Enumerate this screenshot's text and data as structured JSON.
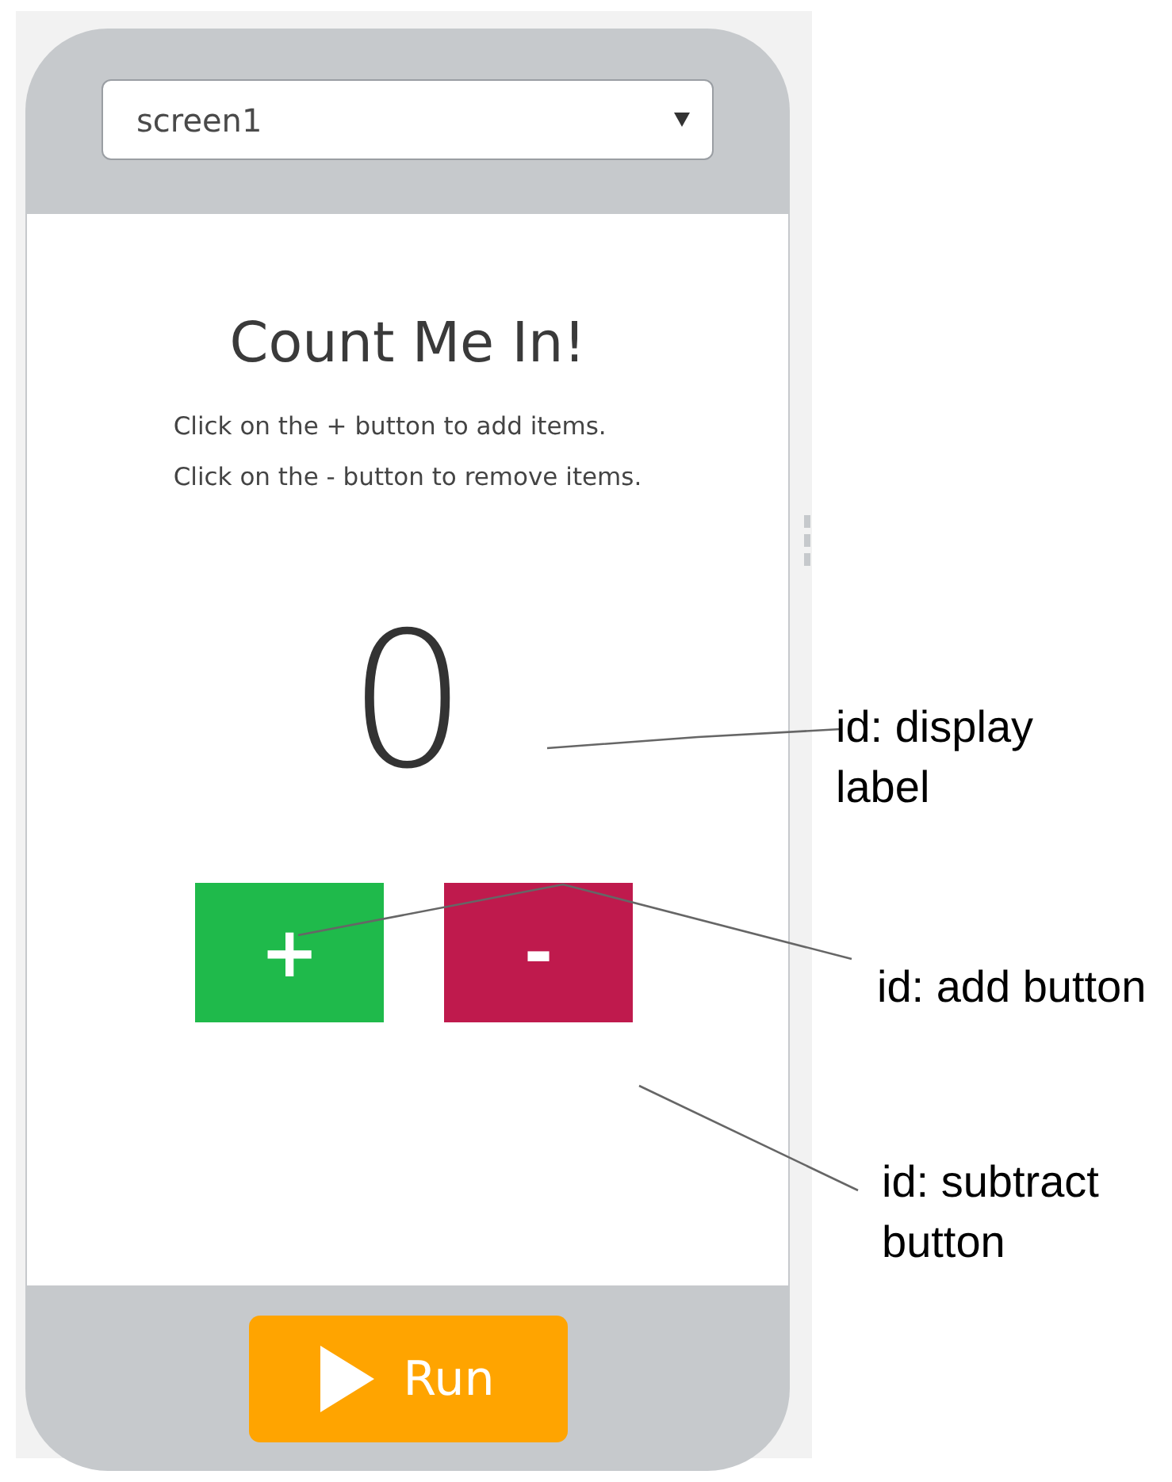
{
  "screen_selector": {
    "value": "screen1"
  },
  "app": {
    "title": "Count Me In!",
    "instructions": [
      "Click on the + button to add items.",
      "Click on the - button to remove items."
    ],
    "display": "0",
    "buttons": [
      {
        "label": "+",
        "color": "#1fba4b"
      },
      {
        "label": "-",
        "color": "#bf1a4d"
      }
    ]
  },
  "run_button": {
    "label": "Run"
  },
  "annotations": [
    {
      "text": "id: display label"
    },
    {
      "text": "id: add button"
    },
    {
      "text": "id: subtract button"
    }
  ]
}
